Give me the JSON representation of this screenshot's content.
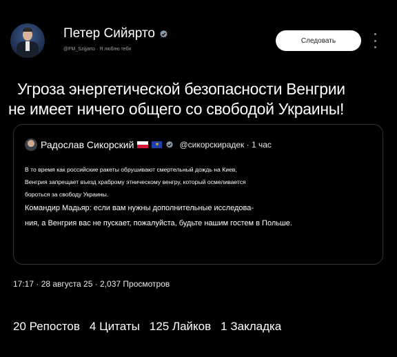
{
  "author": {
    "name": "Петер Сийярто",
    "handle": "@FM_Szijjarto · Я люблю тебя"
  },
  "follow_label": "Следовать",
  "tweet": {
    "lines": [
      "Угроза энергетической безопасности Венгрии",
      "не имеет ничего общего со свободой Украины!"
    ]
  },
  "quoted": {
    "name": "Радослав Сикорский",
    "handle": "@сикорскирадек · 1 час",
    "lines": [
      "В то время как российские ракеты обрушивают смертельный дождь на Киев,",
      "Венгрия запрещает въезд храброму этническому венгру, который осмеливается",
      "бороться за свободу Украины.",
      "Командир Мадьяр: если вам нужны дополнительные исследова-",
      "ния, а Венгрия вас не пускает, пожалуйста, будьте нашим гостем в Польше."
    ],
    "flags": [
      "flag-poland",
      "flag-eu"
    ]
  },
  "meta": "17:17 · 28 августа 25 · 2,037 Просмотров",
  "stats": {
    "reposts": "20 Репостов",
    "quotes": "4 Цитаты",
    "likes": "125 Лайков",
    "bookmarks": "1 Закладка"
  },
  "colors": {
    "background": "#000000",
    "verified_badge": "#8b98a5",
    "follow_button": "#ffffff"
  }
}
